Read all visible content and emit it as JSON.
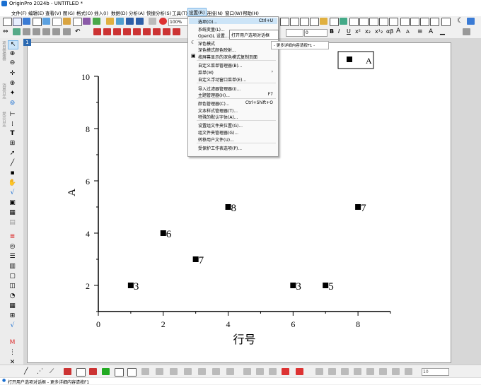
{
  "titlebar": {
    "title": "OriginPro 2024b - UNTITLED *"
  },
  "menubar": {
    "items": [
      "文件(F)",
      "编辑(E)",
      "查看(V)",
      "图(G)",
      "格式(O)",
      "插入(I)",
      "数据(D)",
      "分析(A)",
      "快捷分析(S)",
      "工具(T)",
      "设置(R)",
      "连接(N)",
      "窗口(W)",
      "帮助(H)"
    ],
    "active": "设置(R)"
  },
  "toolbar": {
    "zoom": "100%"
  },
  "format_toolbar": {
    "font_size": "0",
    "buttons": [
      "B",
      "I",
      "U",
      "x²",
      "x₂",
      "x¹₂",
      "αβ",
      "A",
      "A"
    ]
  },
  "left_tabs": [
    "项目管理器",
    "消息日志",
    "提示日志"
  ],
  "layer": {
    "number": "1"
  },
  "settings_menu": {
    "items": [
      {
        "label": "选项(O)...",
        "shortcut": "Ctrl+U",
        "highlighted": true
      },
      {
        "label": "系统变量(L)...",
        "shortcut": ""
      },
      {
        "label": "OpenGL 设置...",
        "shortcut": ""
      },
      {
        "label": "深色模式",
        "shortcut": "",
        "icon": "moon-icon"
      },
      {
        "label": "深色模式颜色映射...",
        "shortcut": ""
      },
      {
        "label": "按屏幕显示的深色模式复制页面",
        "shortcut": "",
        "icon": "copy-icon"
      },
      {
        "label": "自定义菜单管理器(B)...",
        "shortcut": ""
      },
      {
        "label": "菜单(M)",
        "shortcut": "",
        "submenu": true
      },
      {
        "label": "自定义浮动窗口菜单(E)...",
        "shortcut": ""
      },
      {
        "label": "导入过滤器管理器(I)...",
        "shortcut": ""
      },
      {
        "label": "主题管理器(H)...",
        "shortcut": "F7"
      },
      {
        "label": "颜色管理器(C)...",
        "shortcut": "Ctrl+Shift+O"
      },
      {
        "label": "文本样式管理器(T)...",
        "shortcut": ""
      },
      {
        "label": "特殊的默认字体(A)...",
        "shortcut": ""
      },
      {
        "label": "设置组文件夹位置(G)...",
        "shortcut": ""
      },
      {
        "label": "组文件夹管理器(G)...",
        "shortcut": ""
      },
      {
        "label": "转移用户文件(U)...",
        "shortcut": ""
      },
      {
        "label": "受保护工作表选项(P)...",
        "shortcut": ""
      }
    ]
  },
  "tooltip": {
    "text": "打开用户选项对话框"
  },
  "hint": {
    "text": "- 更多详细内容请按F1 -"
  },
  "statusbar": {
    "text": "打开用户选项对话框 - 更多详细内容请按F1"
  },
  "bottom_toolbar": {
    "size_value": "10"
  },
  "chart_data": {
    "type": "scatter",
    "xlabel": "行号",
    "ylabel": "A",
    "xlim": [
      0,
      9
    ],
    "ylim": [
      1,
      10
    ],
    "xticks": [
      "0",
      "2",
      "4",
      "6",
      "8"
    ],
    "yticks": [
      "2",
      "4",
      "6",
      "8",
      "10"
    ],
    "legend": {
      "entries": [
        "A"
      ],
      "placement": "top-right"
    },
    "series": [
      {
        "name": "A",
        "marker": "square",
        "color": "#000000",
        "points": [
          {
            "x": 1,
            "y": 2,
            "label": "3"
          },
          {
            "x": 2,
            "y": 4,
            "label": "6"
          },
          {
            "x": 3,
            "y": 3,
            "label": "7"
          },
          {
            "x": 4,
            "y": 5,
            "label": "8"
          },
          {
            "x": 6,
            "y": 2,
            "label": "3"
          },
          {
            "x": 7,
            "y": 2,
            "label": "5"
          },
          {
            "x": 8,
            "y": 5,
            "label": "7"
          }
        ]
      }
    ]
  }
}
